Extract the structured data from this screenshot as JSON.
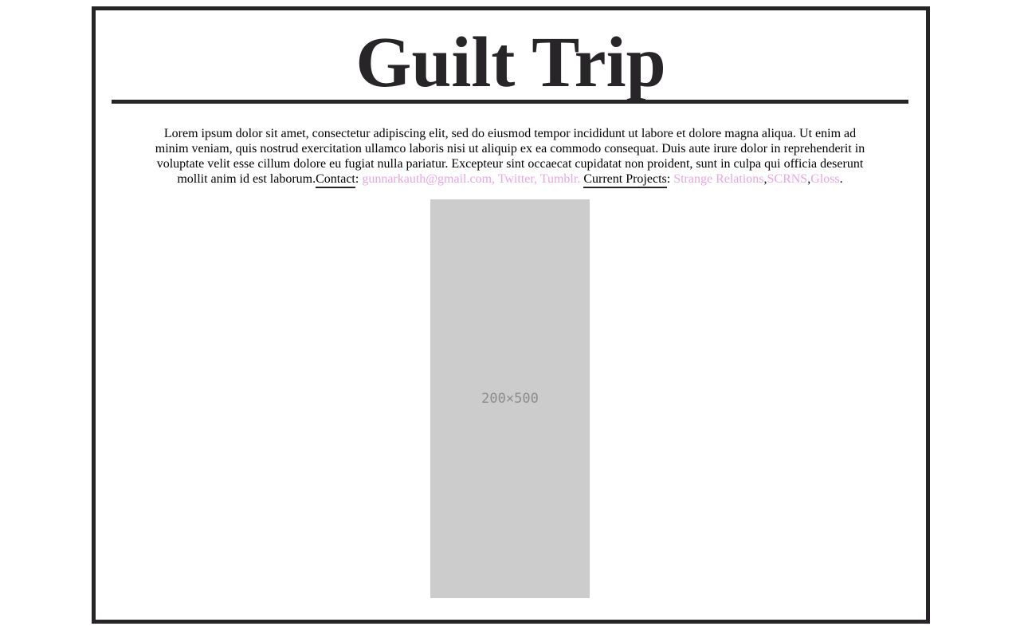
{
  "header": {
    "title": "Guilt Trip"
  },
  "intro": {
    "body": "Lorem ipsum dolor sit amet, consectetur adipiscing elit, sed do eiusmod tempor incididunt ut labore et dolore magna aliqua. Ut enim ad minim veniam, quis nostrud exercitation ullamco laboris nisi ut aliquip ex ea commodo consequat. Duis aute irure dolor in reprehenderit in voluptate velit esse cillum dolore eu fugiat nulla pariatur. Excepteur sint occaecat cupidatat non proident, sunt in culpa qui officia deserunt mollit anim id est laborum.",
    "contact_label": "Contact",
    "contact_colon": ":",
    "contact_links": "gunnarkauth@gmail.com, Twitter, Tumblr.",
    "projects_label": "Current Projects",
    "projects_colon": ":",
    "project_1": "Strange Relations",
    "comma_1": ",",
    "project_2": "SCRNS",
    "comma_2": ",",
    "project_3": "Gloss",
    "end_period": "."
  },
  "image": {
    "placeholder_text": "200×500"
  },
  "colors": {
    "border": "#272527",
    "link_pink": "#e8a6e4",
    "placeholder_bg": "#cccccc",
    "placeholder_text": "#8d8d8d"
  }
}
